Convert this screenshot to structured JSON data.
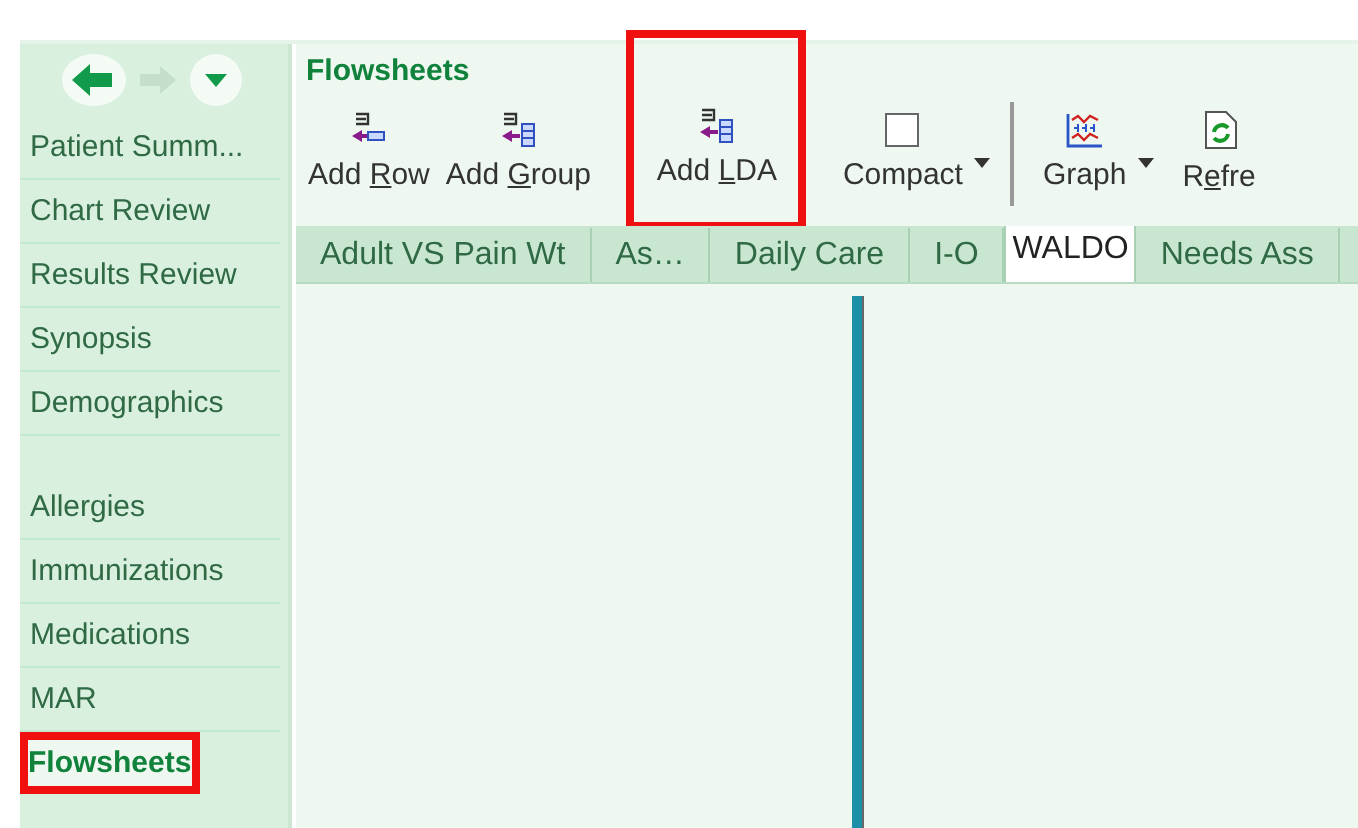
{
  "nav": {
    "back_enabled": true,
    "forward_enabled": false
  },
  "sidebar": {
    "groups": [
      [
        {
          "label": "Patient Summ...",
          "selected": false
        },
        {
          "label": "Chart Review",
          "selected": false
        },
        {
          "label": "Results Review",
          "selected": false
        },
        {
          "label": "Synopsis",
          "selected": false
        },
        {
          "label": "Demographics",
          "selected": false
        }
      ],
      [
        {
          "label": "Allergies",
          "selected": false
        },
        {
          "label": "Immunizations",
          "selected": false
        },
        {
          "label": "Medications",
          "selected": false
        },
        {
          "label": "MAR",
          "selected": false
        },
        {
          "label": "Flowsheets",
          "selected": true,
          "highlighted": true
        }
      ]
    ]
  },
  "activity": {
    "title": "Flowsheets"
  },
  "toolbar": [
    {
      "kind": "add-row",
      "before": "Add ",
      "key": "R",
      "after": "ow",
      "highlighted": false
    },
    {
      "kind": "add-group",
      "before": "Add ",
      "key": "G",
      "after": "roup",
      "highlighted": false
    },
    {
      "kind": "add-lda",
      "before": "Add ",
      "key": "L",
      "after": "DA",
      "highlighted": true
    },
    {
      "kind": "compact",
      "before": "Compact",
      "checked": false,
      "dropdown": true
    },
    {
      "kind": "separator"
    },
    {
      "kind": "graph",
      "before": "Graph",
      "dropdown": true
    },
    {
      "kind": "refresh",
      "before": "R",
      "key": "e",
      "after": "fre"
    }
  ],
  "tabs": [
    {
      "label": "Adult VS Pain Wt",
      "selected": false
    },
    {
      "label": "As…",
      "selected": false
    },
    {
      "label": "Daily Care",
      "selected": false
    },
    {
      "label": "I-O",
      "selected": false
    },
    {
      "label": "WALDO",
      "selected": true
    },
    {
      "label": "Needs Ass",
      "selected": false
    }
  ]
}
